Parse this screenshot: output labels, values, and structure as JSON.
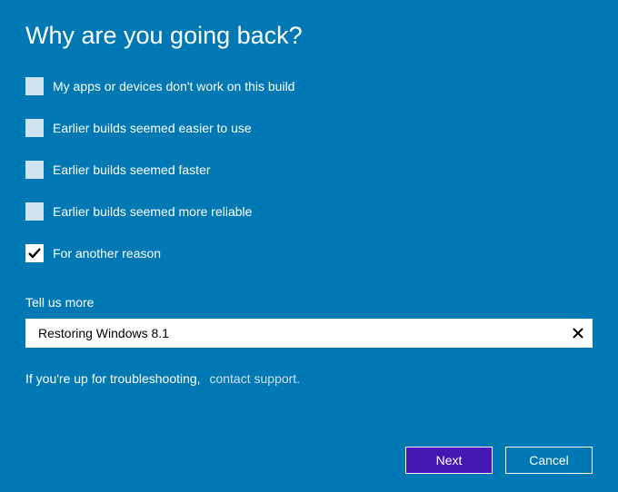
{
  "title": "Why are you going back?",
  "options": [
    {
      "label": "My apps or devices don't work on this build",
      "checked": false
    },
    {
      "label": "Earlier builds seemed easier to use",
      "checked": false
    },
    {
      "label": "Earlier builds seemed faster",
      "checked": false
    },
    {
      "label": "Earlier builds seemed more reliable",
      "checked": false
    },
    {
      "label": "For another reason",
      "checked": true
    }
  ],
  "tell_more_label": "Tell us more",
  "tell_more_value": "Restoring Windows 8.1",
  "troubleshoot": {
    "prefix": "If you're up for troubleshooting,",
    "link": "contact support."
  },
  "buttons": {
    "next": "Next",
    "cancel": "Cancel"
  }
}
